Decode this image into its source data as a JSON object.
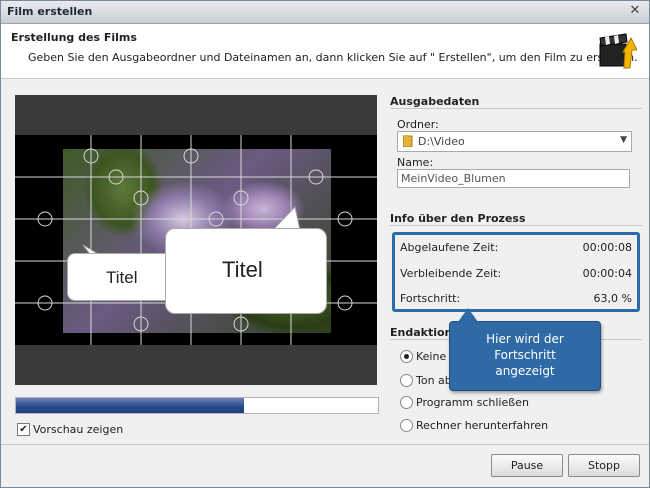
{
  "window": {
    "title": "Film erstellen",
    "close_glyph": "✕"
  },
  "header": {
    "title": "Erstellung des Films",
    "subtitle": "Geben Sie den Ausgabeordner und Dateinamen an, dann klicken Sie auf \" Erstellen\", um den Film zu erstellen.",
    "logo_icon": "clapperboard-arrow-icon"
  },
  "preview": {
    "bubble_small_text": "Titel",
    "bubble_large_text": "Titel",
    "progress_fraction": 0.63,
    "show_preview_label": "Vorschau zeigen",
    "show_preview_checked": true
  },
  "output": {
    "section_title": "Ausgabedaten",
    "folder_label": "Ordner:",
    "folder_value": "D:\\Video",
    "name_label": "Name:",
    "name_value": "MeinVideo_Blumen"
  },
  "process": {
    "section_title": "Info über den Prozess",
    "elapsed_label": "Abgelaufene Zeit:",
    "elapsed_value": "00:00:08",
    "remaining_label": "Verbleibende Zeit:",
    "remaining_value": "00:00:04",
    "progress_label": "Fortschritt:",
    "progress_value": "63,0 %"
  },
  "end_actions": {
    "section_title": "Endaktionen",
    "options": [
      {
        "label": "Keine A",
        "selected": true
      },
      {
        "label": "Ton abs",
        "selected": false
      },
      {
        "label": "Programm schließen",
        "selected": false
      },
      {
        "label": "Rechner herunterfahren",
        "selected": false
      }
    ]
  },
  "tooltip": {
    "line1": "Hier wird der",
    "line2": "Fortschritt",
    "line3": "angezeigt"
  },
  "buttons": {
    "pause": "Pause",
    "stop": "Stopp"
  },
  "colors": {
    "accent": "#2d6aa8",
    "progress": "#2b4a8e"
  }
}
